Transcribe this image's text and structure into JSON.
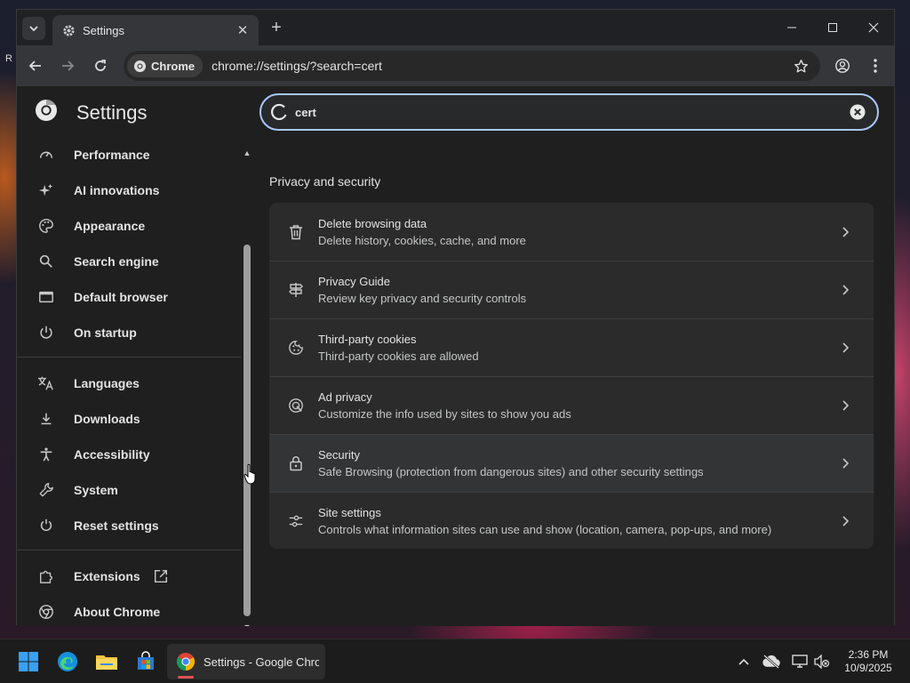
{
  "desktop": {
    "edge_text": "R"
  },
  "window": {
    "tab_title": "Settings",
    "url": "chrome://settings/?search=cert",
    "chip_label": "Chrome"
  },
  "settings": {
    "title": "Settings",
    "search_value": "cert",
    "sidebar": [
      {
        "label": "Performance",
        "icon": "speedometer-icon"
      },
      {
        "label": "AI innovations",
        "icon": "sparkle-icon"
      },
      {
        "label": "Appearance",
        "icon": "palette-icon"
      },
      {
        "label": "Search engine",
        "icon": "search-icon"
      },
      {
        "label": "Default browser",
        "icon": "browser-window-icon"
      },
      {
        "label": "On startup",
        "icon": "power-icon"
      },
      {
        "label": "Languages",
        "icon": "translate-icon"
      },
      {
        "label": "Downloads",
        "icon": "download-icon"
      },
      {
        "label": "Accessibility",
        "icon": "accessibility-icon"
      },
      {
        "label": "System",
        "icon": "wrench-icon"
      },
      {
        "label": "Reset settings",
        "icon": "reset-icon"
      },
      {
        "label": "Extensions",
        "icon": "puzzle-icon"
      },
      {
        "label": "About Chrome",
        "icon": "chrome-icon"
      }
    ],
    "section_title": "Privacy and security",
    "rows": [
      {
        "title": "Delete browsing data",
        "subtitle": "Delete history, cookies, cache, and more",
        "icon": "trash-icon"
      },
      {
        "title": "Privacy Guide",
        "subtitle": "Review key privacy and security controls",
        "icon": "signpost-icon"
      },
      {
        "title": "Third-party cookies",
        "subtitle": "Third-party cookies are allowed",
        "icon": "cookie-icon"
      },
      {
        "title": "Ad privacy",
        "subtitle": "Customize the info used by sites to show you ads",
        "icon": "ad-privacy-icon"
      },
      {
        "title": "Security",
        "subtitle": "Safe Browsing (protection from dangerous sites) and other security settings",
        "icon": "lock-icon"
      },
      {
        "title": "Site settings",
        "subtitle": "Controls what information sites can use and show (location, camera, pop-ups, and more)",
        "icon": "sliders-icon"
      }
    ]
  },
  "taskbar": {
    "active_app_label": "Settings - Google Chror",
    "time": "2:36 PM",
    "date": "10/9/2025"
  },
  "colors": {
    "focus_ring": "#a8c7fa",
    "surface": "#2b2b2b",
    "background": "#1f1f1f"
  }
}
